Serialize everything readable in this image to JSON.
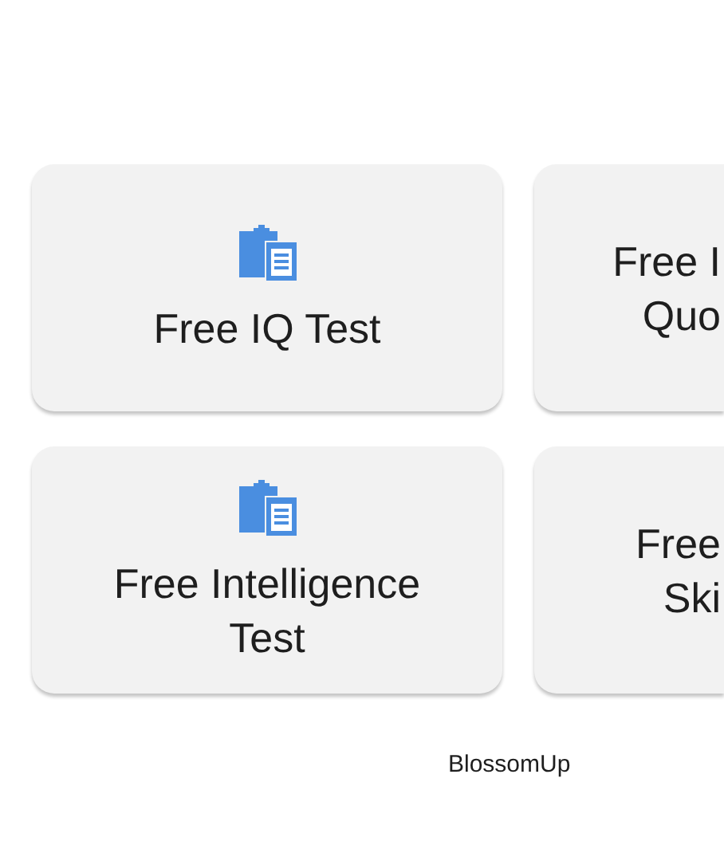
{
  "cards": [
    {
      "kind": "full",
      "label": "Free IQ Test"
    },
    {
      "kind": "cut",
      "label": "Free I\nQuo"
    },
    {
      "kind": "full",
      "label": "Free Intelligence Test"
    },
    {
      "kind": "cut",
      "label": "Free\nSki"
    }
  ],
  "footer": "BlossomUp"
}
